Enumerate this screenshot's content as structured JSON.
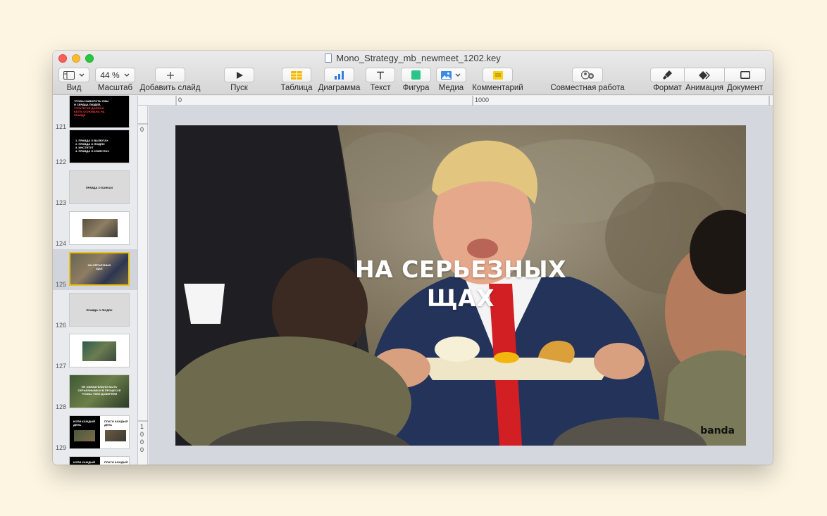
{
  "window": {
    "title": "Mono_Strategy_mb_newmeet_1202.key"
  },
  "toolbar": {
    "view": {
      "label": "Вид"
    },
    "zoom": {
      "value": "44 %",
      "label": "Масштаб"
    },
    "add_slide": {
      "label": "Добавить слайд"
    },
    "play": {
      "label": "Пуск"
    },
    "table": {
      "label": "Таблица"
    },
    "chart": {
      "label": "Диаграмма"
    },
    "text": {
      "label": "Текст"
    },
    "shape": {
      "label": "Фигура"
    },
    "media": {
      "label": "Медиа"
    },
    "comment": {
      "label": "Комментарий"
    },
    "collaborate": {
      "label": "Совместная работа"
    },
    "format": {
      "label": "Формат"
    },
    "animate": {
      "label": "Анимация"
    },
    "document": {
      "label": "Документ"
    }
  },
  "rulers": {
    "top": {
      "zero": "0",
      "thousand": "1000"
    },
    "left": {
      "zero": "0",
      "thousand": [
        "1",
        "0",
        "0",
        "0"
      ]
    }
  },
  "slides": [
    {
      "number": "121",
      "lines": [
        "ЧТОБЫ ЗАВОРОТЬ УМЫ",
        "И СЕРДЦА ЛЮДЕЙ,",
        "СТРАТЕГИЯ ДОЛЖНА",
        "БЫТЬ ОСНОВАНА НА",
        "ПРАВДЕ"
      ]
    },
    {
      "number": "122",
      "lines": [
        "1. ПРАВДА О ВАЛЮТАХ",
        "2. ПРАВДА О ЛЮДЯХ",
        "3. ИНСТИТУТ",
        "4. ПРАВДА О КЛИЕНТАХ"
      ]
    },
    {
      "number": "123",
      "lines": [
        "ПРАВДА О БАНКАХ"
      ]
    },
    {
      "number": "124",
      "lines": []
    },
    {
      "number": "125",
      "lines": [
        "НА СЕРЬЕЗНЫХ",
        "ЩАХ"
      ]
    },
    {
      "number": "126",
      "lines": [
        "ПРАВДА О ЛЮДЯХ"
      ]
    },
    {
      "number": "127",
      "lines": []
    },
    {
      "number": "128",
      "lines": [
        "НЕ ОБЯЗАТЕЛЬНО БЫТЬ",
        "СЕРЬЕЗНЫМИ И В ПРОЦЕССЕ",
        "ЧТОБЫ ТЕБЕ ДОВЕРЯЛИ"
      ]
    },
    {
      "number": "129",
      "lines": [
        "КОПИ КАЖДЫЙ",
        "ДЕНЬ",
        "ПЛАТИ КАЖДЫЙ",
        "ДЕНЬ"
      ]
    },
    {
      "number": "",
      "lines": [
        "КОПИ КАЖДЫЙ",
        "ПЛАТИ КАЖДЫЙ"
      ]
    }
  ],
  "current_slide": {
    "title_line1": "НА СЕРЬЕЗНЫХ",
    "title_line2": "ЩАХ",
    "brand": "banda"
  }
}
